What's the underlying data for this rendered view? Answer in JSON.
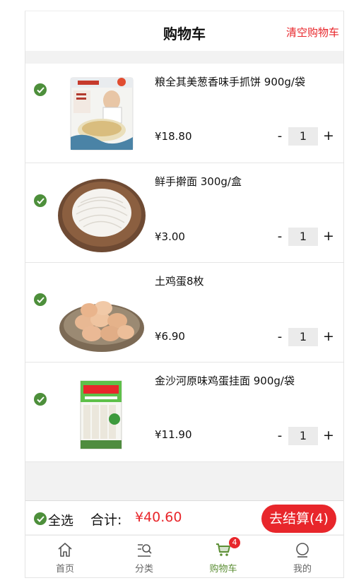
{
  "header": {
    "title": "购物车",
    "clear_label": "清空购物车"
  },
  "items": [
    {
      "name": "粮全其美葱香味手抓饼 900g/袋",
      "price": "¥18.80",
      "qty": "1",
      "checked": true
    },
    {
      "name": "鲜手擀面 300g/盒",
      "price": "¥3.00",
      "qty": "1",
      "checked": true
    },
    {
      "name": "土鸡蛋8枚",
      "price": "¥6.90",
      "qty": "1",
      "checked": true
    },
    {
      "name": "金沙河原味鸡蛋挂面 900g/袋",
      "price": "¥11.90",
      "qty": "1",
      "checked": true
    }
  ],
  "stepper": {
    "minus": "-",
    "plus": "+"
  },
  "footer": {
    "select_all": "全选",
    "total_label": "合计:",
    "total_value": "¥40.60",
    "checkout_label": "去结算(4)"
  },
  "tabbar": {
    "tabs": [
      {
        "label": "首页",
        "icon": "home-icon"
      },
      {
        "label": "分类",
        "icon": "category-icon"
      },
      {
        "label": "购物车",
        "icon": "cart-icon",
        "badge": "4",
        "active": true
      },
      {
        "label": "我的",
        "icon": "profile-icon"
      }
    ]
  },
  "colors": {
    "accent_red": "#e8262b",
    "check_green": "#4d8f3b",
    "tab_active": "#5d8f36"
  }
}
